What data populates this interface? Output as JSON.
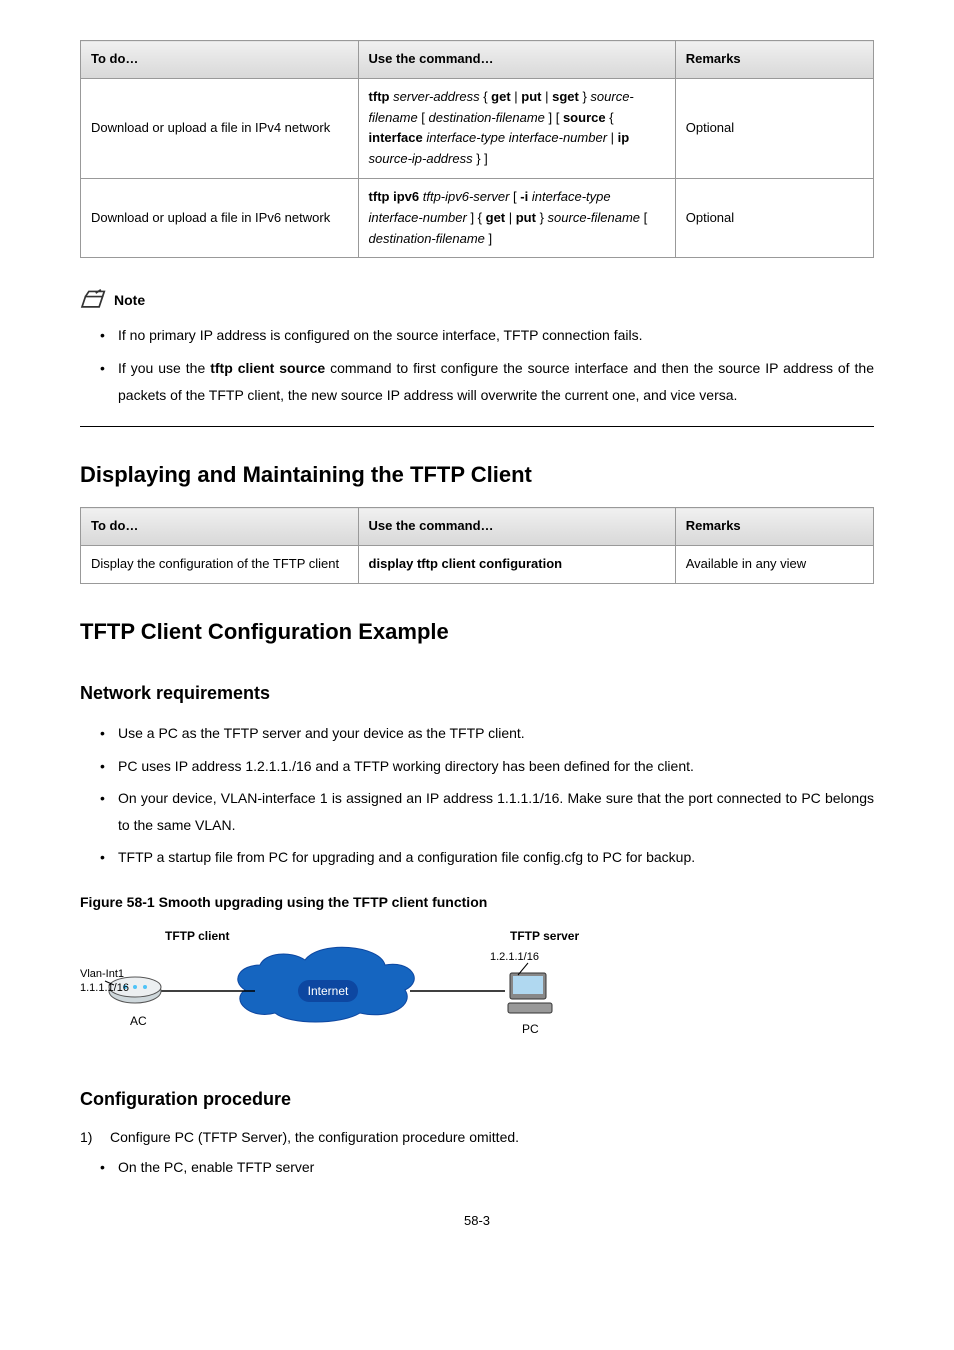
{
  "table1": {
    "headers": [
      "To do…",
      "Use the command…",
      "Remarks"
    ],
    "rows": [
      {
        "desc": "Download or upload a file in IPv4 network",
        "cmd_parts": [
          {
            "t": "tftp",
            "b": true
          },
          {
            "t": " "
          },
          {
            "t": "server-address",
            "i": true
          },
          {
            "t": " { "
          },
          {
            "t": "get",
            "b": true
          },
          {
            "t": " | "
          },
          {
            "t": "put",
            "b": true
          },
          {
            "t": " | "
          },
          {
            "t": "sget",
            "b": true
          },
          {
            "t": " } "
          },
          {
            "t": "source-filename",
            "i": true
          },
          {
            "t": " [ "
          },
          {
            "t": "destination-filename",
            "i": true
          },
          {
            "t": " ] [ "
          },
          {
            "t": "source",
            "b": true
          },
          {
            "t": " { "
          },
          {
            "t": "interface",
            "b": true
          },
          {
            "t": " "
          },
          {
            "t": "interface-type interface-number",
            "i": true
          },
          {
            "t": " | "
          },
          {
            "t": "ip",
            "b": true
          },
          {
            "t": " "
          },
          {
            "t": "source-ip-address",
            "i": true
          },
          {
            "t": " } ]"
          }
        ],
        "remark": "Optional"
      },
      {
        "desc": "Download or upload a file in IPv6 network",
        "cmd_parts": [
          {
            "t": "tftp ipv6",
            "b": true
          },
          {
            "t": " "
          },
          {
            "t": "tftp-ipv6-server",
            "i": true
          },
          {
            "t": " [ "
          },
          {
            "t": "-i",
            "b": true
          },
          {
            "t": " "
          },
          {
            "t": "interface-type interface-number",
            "i": true
          },
          {
            "t": " ] { "
          },
          {
            "t": "get",
            "b": true
          },
          {
            "t": " | "
          },
          {
            "t": "put",
            "b": true
          },
          {
            "t": " } "
          },
          {
            "t": "source-filename",
            "i": true
          },
          {
            "t": " [ "
          },
          {
            "t": "destination-filename",
            "i": true
          },
          {
            "t": " ]"
          }
        ],
        "remark": "Optional"
      }
    ]
  },
  "note": {
    "label": "Note",
    "items": [
      {
        "text": "If no primary IP address is configured on the source interface, TFTP connection fails."
      },
      {
        "text_pre": "If you use the ",
        "cmd": "tftp client source",
        "text_post": " command to first configure the source interface and then the source IP address of the packets of the TFTP client, the new source IP address will overwrite the current one, and vice versa."
      }
    ]
  },
  "h2_display": "Displaying and Maintaining the TFTP Client",
  "table2": {
    "headers": [
      "To do…",
      "Use the command…",
      "Remarks"
    ],
    "row": {
      "desc": "Display the configuration of the TFTP client",
      "cmd_parts": [
        {
          "t": "display tftp client configuration",
          "b": true
        }
      ],
      "remark": "Available in any view"
    }
  },
  "h2_example": "TFTP Client Configuration Example",
  "h3_netreq": "Network requirements",
  "netreq_items": [
    "Use a PC as the TFTP server and your device as the TFTP client.",
    "PC uses IP address 1.2.1.1./16 and a TFTP working directory has been defined for the client.",
    "On your device, VLAN-interface 1 is assigned an IP address 1.1.1.1/16. Make sure that the port connected to PC belongs to the same VLAN.",
    "TFTP a startup file from PC for upgrading and a configuration file config.cfg to PC for backup."
  ],
  "figure": {
    "caption": "Figure 58-1 Smooth upgrading using the TFTP client function",
    "tftp_client": "TFTP client",
    "tftp_server": "TFTP server",
    "vlan": "Vlan-Int1",
    "ip1": "1.1.1.1/16",
    "ip2": "1.2.1.1/16",
    "internet": "Internet",
    "ac": "AC",
    "pc": "PC"
  },
  "h3_cfgproc": "Configuration procedure",
  "cfg_step1": "Configure PC (TFTP Server), the configuration procedure omitted.",
  "cfg_bullet": "On the PC, enable TFTP server",
  "pagenum": "58-3"
}
